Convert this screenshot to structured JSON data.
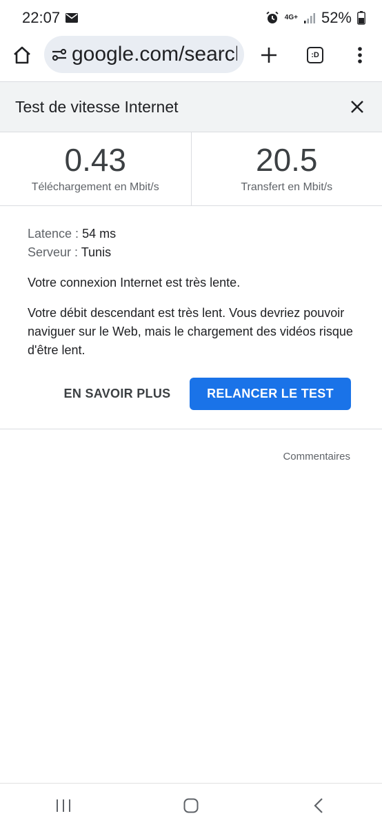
{
  "status_bar": {
    "time": "22:07",
    "network": "4G+",
    "battery": "52%",
    "icons": [
      "mail-icon",
      "alarm-icon",
      "signal-icon",
      "battery-icon"
    ]
  },
  "browser": {
    "url": "google.com/search",
    "tab_count": ":D",
    "icons": [
      "home-icon",
      "site-settings-icon",
      "new-tab-icon",
      "tab-switcher-icon",
      "more-options-icon"
    ]
  },
  "dialog": {
    "title": "Test de vitesse Internet"
  },
  "metrics": {
    "download": {
      "value": "0.43",
      "label": "Téléchargement en Mbit/s"
    },
    "upload": {
      "value": "20.5",
      "label": "Transfert en Mbit/s"
    }
  },
  "details": {
    "latency_label": "Latence :",
    "latency_value": "54 ms",
    "server_label": "Serveur :",
    "server_value": "Tunis",
    "summary": "Votre connexion Internet est très lente.",
    "description": "Votre débit descendant est très lent. Vous devriez pouvoir naviguer sur le Web, mais le chargement des vidéos risque d'être lent."
  },
  "actions": {
    "learn_more": "EN SAVOIR PLUS",
    "rerun": "RELANCER LE TEST"
  },
  "feedback": "Commentaires",
  "colors": {
    "accent": "#1a73e8",
    "header_bg": "#f1f3f4",
    "url_bg": "#e9edf3"
  }
}
